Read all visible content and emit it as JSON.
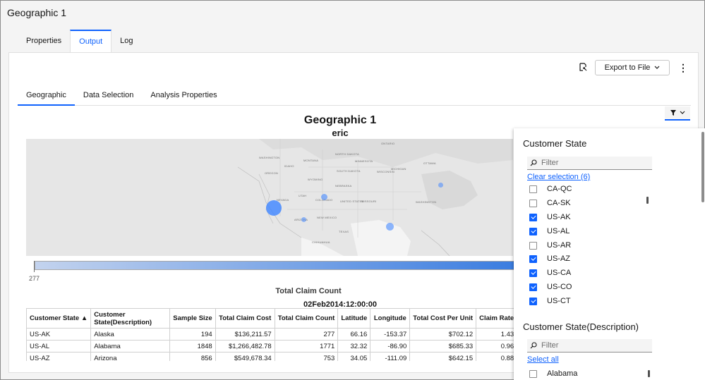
{
  "window": {
    "title": "Geographic 1"
  },
  "top_tabs": [
    {
      "label": "Properties",
      "active": false
    },
    {
      "label": "Output",
      "active": true
    },
    {
      "label": "Log",
      "active": false
    }
  ],
  "toolbar": {
    "export_label": "Export to File"
  },
  "sub_tabs": [
    {
      "label": "Geographic",
      "active": true
    },
    {
      "label": "Data Selection",
      "active": false
    },
    {
      "label": "Analysis Properties",
      "active": false
    }
  ],
  "chart": {
    "title": "Geographic 1",
    "subtitle": "eric",
    "legend_min": "277",
    "legend_title": "Total Claim Count",
    "date": "02Feb2014:12:00:00"
  },
  "map_labels": [
    "Washington",
    "Montana",
    "North Dakota",
    "Minnesota",
    "Ontario",
    "Oregon",
    "Idaho",
    "South Dakota",
    "Wisconsin",
    "Michigan",
    "Ottawa",
    "Wyoming",
    "Nebraska",
    "Nevada",
    "Utah",
    "Colorado",
    "United States",
    "Missouri",
    "Washington",
    "Arizona",
    "New Mexico",
    "Texas",
    "Chihuahua"
  ],
  "chart_data": {
    "type": "table",
    "columns": [
      "Customer State",
      "Customer State(Description)",
      "Sample Size",
      "Total Claim Cost",
      "Total Claim Count",
      "Latitude",
      "Longitude",
      "Total Cost Per Unit",
      "Claim Rate"
    ],
    "sort_column": "Customer State",
    "sort_direction": "ascending",
    "rows": [
      [
        "US-AK",
        "Alaska",
        "194",
        "$136,211.57",
        "277",
        "66.16",
        "-153.37",
        "$702.12",
        "1.43"
      ],
      [
        "US-AL",
        "Alabama",
        "1848",
        "$1,266,482.78",
        "1771",
        "32.32",
        "-86.90",
        "$685.33",
        "0.96"
      ],
      [
        "US-AZ",
        "Arizona",
        "856",
        "$549,678.34",
        "753",
        "34.05",
        "-111.09",
        "$642.15",
        "0.88"
      ]
    ]
  },
  "filter_panel": {
    "state_heading": "Customer State",
    "filter_placeholder": "Filter",
    "clear_selection": "Clear selection (6)",
    "state_items": [
      {
        "label": "CA-QC",
        "checked": false
      },
      {
        "label": "CA-SK",
        "checked": false
      },
      {
        "label": "US-AK",
        "checked": true
      },
      {
        "label": "US-AL",
        "checked": true
      },
      {
        "label": "US-AR",
        "checked": false
      },
      {
        "label": "US-AZ",
        "checked": true
      },
      {
        "label": "US-CA",
        "checked": true
      },
      {
        "label": "US-CO",
        "checked": true
      },
      {
        "label": "US-CT",
        "checked": true
      }
    ],
    "desc_heading": "Customer State(Description)",
    "select_all": "Select all",
    "desc_items": [
      {
        "label": "Alabama",
        "checked": false
      }
    ]
  },
  "colors": {
    "accent": "#0f62fe",
    "bubble": "#4589ff"
  }
}
